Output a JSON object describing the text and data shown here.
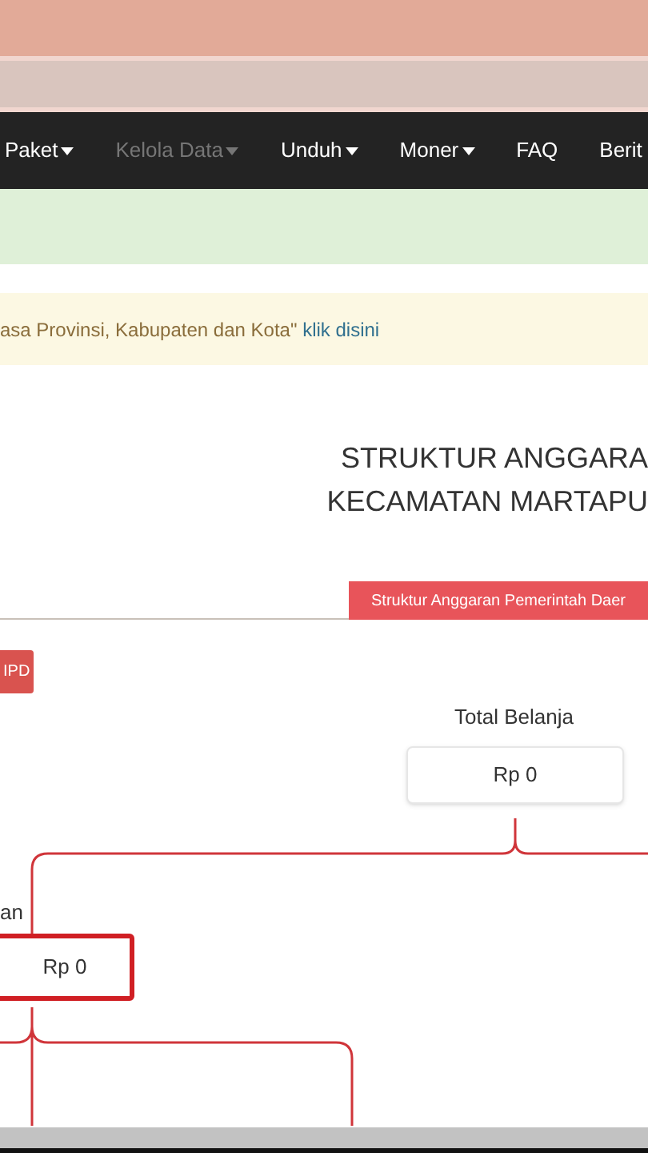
{
  "nav": {
    "items": [
      {
        "label": "Paket",
        "caret": true,
        "disabled": false
      },
      {
        "label": "Kelola Data",
        "caret": true,
        "disabled": true
      },
      {
        "label": "Unduh",
        "caret": true,
        "disabled": false
      },
      {
        "label": "Moner",
        "caret": true,
        "disabled": false
      },
      {
        "label": "FAQ",
        "caret": false,
        "disabled": false
      },
      {
        "label": "Berit",
        "caret": false,
        "disabled": false
      }
    ]
  },
  "notice": {
    "text": "asa Provinsi, Kabupaten dan Kota\"",
    "link": "klik disini"
  },
  "title_lines": [
    "STRUKTUR ANGGARA",
    "KECAMATAN MARTAPU"
  ],
  "tab": {
    "label": "Struktur Anggaran Pemerintah Daer",
    "selected": true
  },
  "button": "IPD",
  "diagram": {
    "nodes": [
      {
        "label": "Total Belanja",
        "value": "Rp 0",
        "selected": false
      },
      {
        "label": "an",
        "value": "Rp 0",
        "selected": true
      }
    ]
  }
}
